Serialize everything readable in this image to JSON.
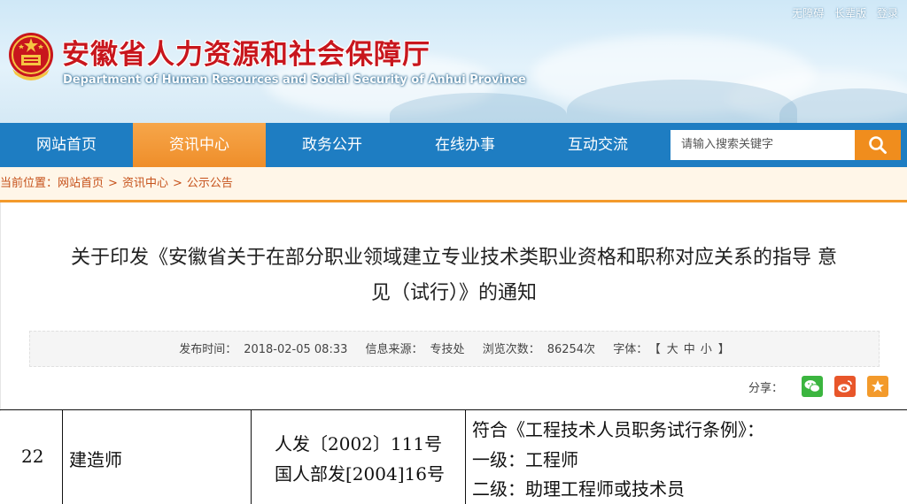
{
  "header": {
    "top_links": [
      "无障碍",
      "长辈版",
      "登录"
    ],
    "title": "安徽省人力资源和社会保障厅",
    "subtitle": "Department of Human Resources and Social Security of Anhui Province"
  },
  "nav": {
    "items": [
      {
        "label": "网站首页",
        "active": false
      },
      {
        "label": "资讯中心",
        "active": true
      },
      {
        "label": "政务公开",
        "active": false
      },
      {
        "label": "在线办事",
        "active": false
      },
      {
        "label": "互动交流",
        "active": false
      }
    ],
    "search_placeholder": "请输入搜索关键字",
    "search_icon": "search-icon"
  },
  "breadcrumb": {
    "prefix": "当前位置：",
    "items": [
      "网站首页",
      "资讯中心",
      "公示公告"
    ],
    "separator": ">"
  },
  "article": {
    "title_line1": "关于印发《安徽省关于在部分职业领域建立专业技术类职业资格和职称对应关系的指导 意",
    "title_line2": "见（试行）》的通知",
    "publish_label": "发布时间：",
    "publish_time": "2018-02-05 08:33",
    "source_label": "信息来源：",
    "source": "专技处",
    "views_label": "浏览次数：",
    "views": "86254次",
    "font_label": "字体：",
    "font_open": "【",
    "font_sizes": [
      "大",
      "中",
      "小"
    ],
    "font_close": "】",
    "share_label": "分享："
  },
  "share_buttons": [
    {
      "name": "wechat-share-icon",
      "color": "#3bb53f"
    },
    {
      "name": "weibo-share-icon",
      "color": "#e8562a"
    },
    {
      "name": "favorite-star-icon",
      "color": "#f39a2b"
    }
  ],
  "table_row": {
    "number": "22",
    "name": "建造师",
    "docs": [
      "人发〔2002〕111号",
      "国人部发[2004]16号"
    ],
    "requirements": [
      "符合《工程技术人员职务试行条例》：",
      "一级：工程师",
      "二级：助理工程师或技术员"
    ]
  },
  "colors": {
    "nav_bg": "#1e7dc2",
    "nav_active": "#ef8e2a",
    "title_red": "#c8161d",
    "breadcrumb_text": "#c6521b",
    "search_button": "#f08d1d"
  }
}
